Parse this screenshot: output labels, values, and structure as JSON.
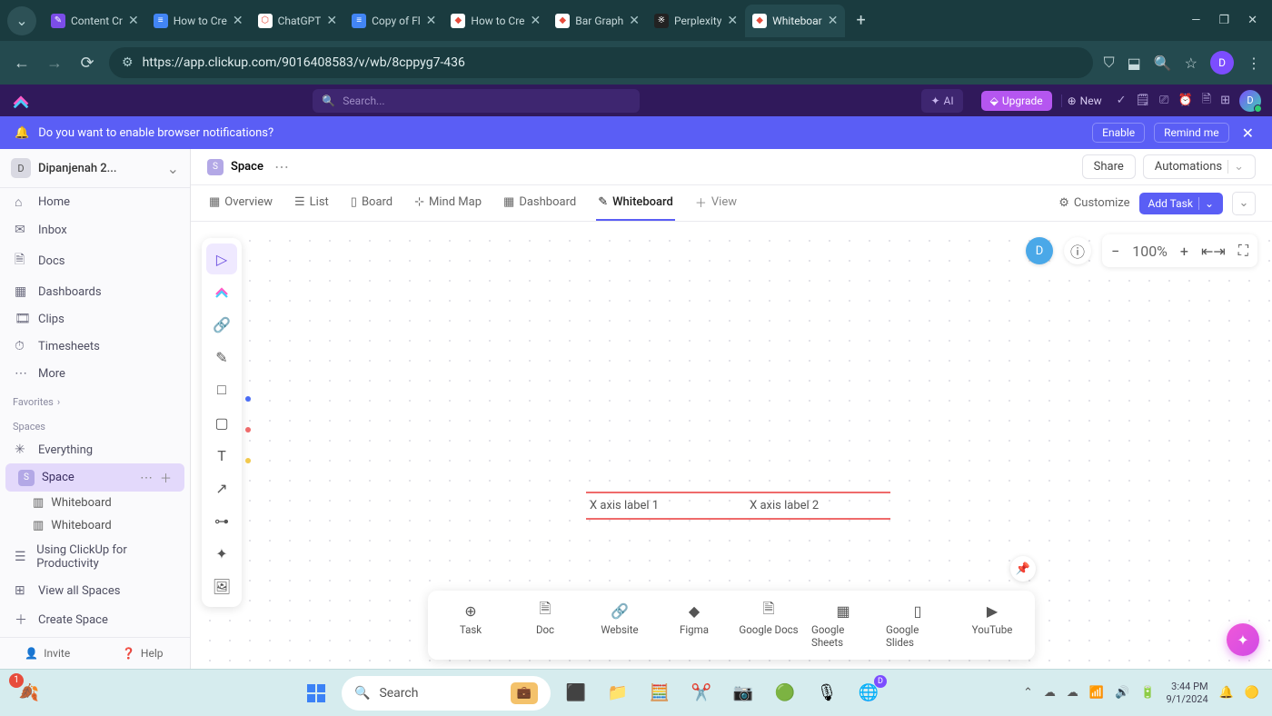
{
  "browser": {
    "tabs": [
      {
        "title": "Content Cr",
        "favicon_bg": "#7b4de8",
        "favicon_text": "✎"
      },
      {
        "title": "How to Cre",
        "favicon_bg": "#4285f4",
        "favicon_text": "≡"
      },
      {
        "title": "ChatGPT",
        "favicon_bg": "#fff",
        "favicon_text": "⬡"
      },
      {
        "title": "Copy of Fl",
        "favicon_bg": "#4285f4",
        "favicon_text": "≡"
      },
      {
        "title": "How to Cre",
        "favicon_bg": "#fff",
        "favicon_text": "◆"
      },
      {
        "title": "Bar Graph",
        "favicon_bg": "#fff",
        "favicon_text": "◆"
      },
      {
        "title": "Perplexity",
        "favicon_bg": "#222",
        "favicon_text": "※"
      },
      {
        "title": "Whiteboar",
        "favicon_bg": "#fff",
        "favicon_text": "◆",
        "active": true
      }
    ],
    "url": "https://app.clickup.com/9016408583/v/wb/8cppyg7-436",
    "avatar_letter": "D"
  },
  "app_header": {
    "search_placeholder": "Search...",
    "ai_label": "AI",
    "upgrade_label": "Upgrade",
    "new_label": "New",
    "avatar_letter": "D"
  },
  "notif": {
    "text": "Do you want to enable browser notifications?",
    "enable": "Enable",
    "remind": "Remind me"
  },
  "sidebar": {
    "workspace": {
      "badge": "D",
      "name": "Dipanjenah 2..."
    },
    "nav": [
      {
        "icon": "⌂",
        "label": "Home"
      },
      {
        "icon": "✉",
        "label": "Inbox"
      },
      {
        "icon": "🗎",
        "label": "Docs"
      },
      {
        "icon": "▦",
        "label": "Dashboards"
      },
      {
        "icon": "🎞",
        "label": "Clips"
      },
      {
        "icon": "⏱",
        "label": "Timesheets"
      },
      {
        "icon": "⋯",
        "label": "More"
      }
    ],
    "favorites_label": "Favorites",
    "spaces_label": "Spaces",
    "everything": {
      "icon": "✳",
      "label": "Everything"
    },
    "space": {
      "badge": "S",
      "label": "Space"
    },
    "space_children": [
      {
        "icon": "▥",
        "label": "Whiteboard"
      },
      {
        "icon": "▥",
        "label": "Whiteboard"
      }
    ],
    "shared": {
      "icon": "☰",
      "label": "Using ClickUp for Productivity"
    },
    "view_all": {
      "icon": "⊞",
      "label": "View all Spaces"
    },
    "create_space": {
      "icon": "＋",
      "label": "Create Space"
    },
    "invite": "Invite",
    "help": "Help"
  },
  "breadcrumb": {
    "badge": "S",
    "name": "Space",
    "share": "Share",
    "automations": "Automations"
  },
  "views": {
    "tabs": [
      {
        "icon": "▦",
        "label": "Overview"
      },
      {
        "icon": "☰",
        "label": "List"
      },
      {
        "icon": "▯",
        "label": "Board"
      },
      {
        "icon": "⊹",
        "label": "Mind Map"
      },
      {
        "icon": "▦",
        "label": "Dashboard"
      },
      {
        "icon": "✎",
        "label": "Whiteboard",
        "active": true
      },
      {
        "icon": "＋",
        "label": "View",
        "add": true
      }
    ],
    "customize": "Customize",
    "add_task": "Add Task"
  },
  "whiteboard": {
    "zoom": "100%",
    "avatar_letter": "D",
    "labels": [
      "X axis label 1",
      "X axis label 2"
    ]
  },
  "dock": [
    {
      "icon": "⊕",
      "label": "Task"
    },
    {
      "icon": "🗎",
      "label": "Doc"
    },
    {
      "icon": "🔗",
      "label": "Website"
    },
    {
      "icon": "◆",
      "label": "Figma"
    },
    {
      "icon": "🗎",
      "label": "Google Docs"
    },
    {
      "icon": "▦",
      "label": "Google Sheets"
    },
    {
      "icon": "▯",
      "label": "Google Slides"
    },
    {
      "icon": "▶",
      "label": "YouTube"
    }
  ],
  "taskbar": {
    "search_placeholder": "Search",
    "time": "3:44 PM",
    "date": "9/1/2024"
  }
}
